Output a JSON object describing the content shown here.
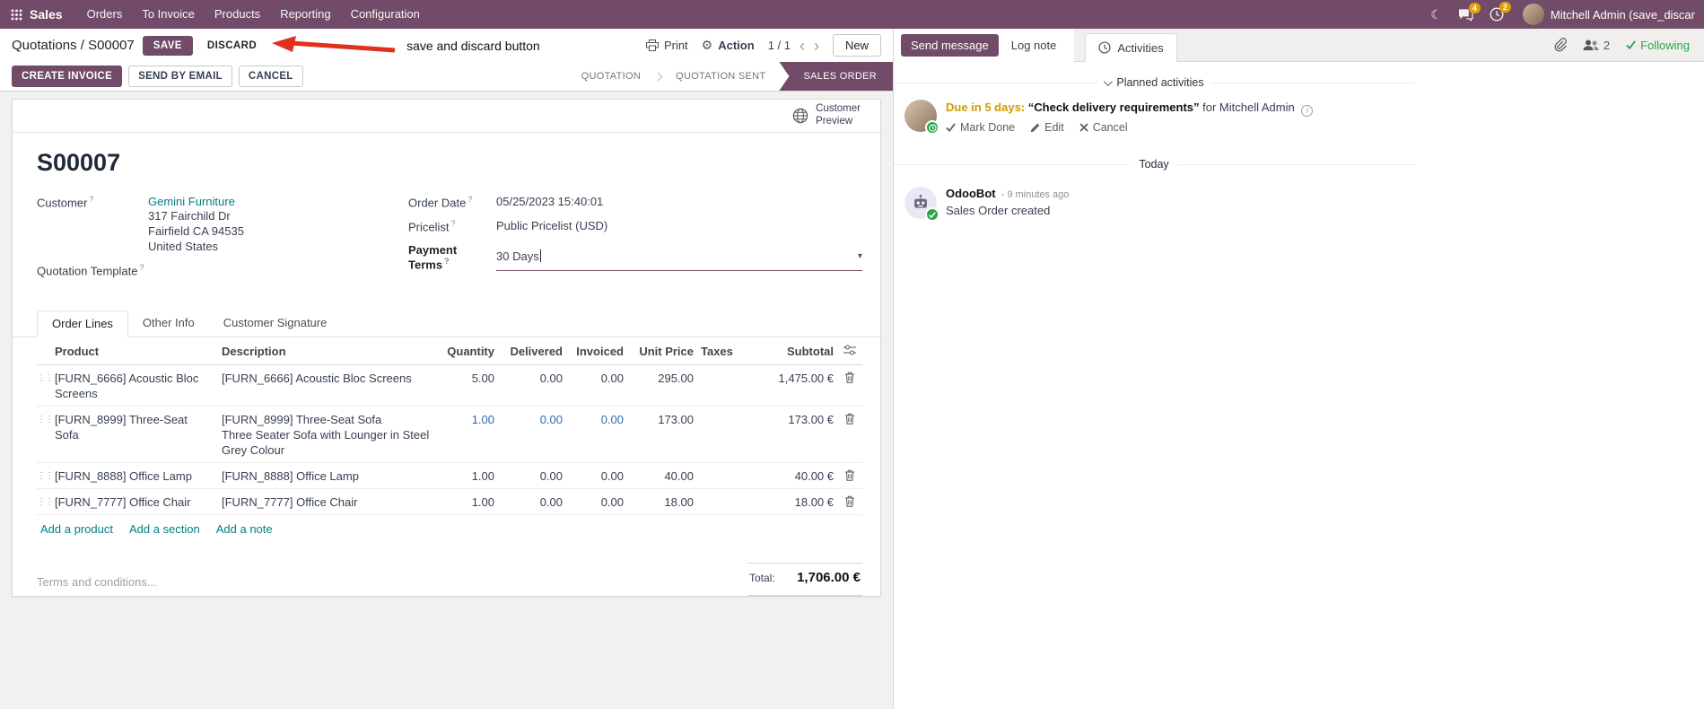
{
  "colors": {
    "topbar_bg": "#714B67",
    "primary_button": "#714B67",
    "link_teal": "#017E84",
    "modified_value_blue": "#2B6CB0",
    "activity_due_amber": "#CE9B00",
    "following_green": "#28A745",
    "annotation_red": "#E0301E",
    "notification_badge": "#E3A008"
  },
  "topbar": {
    "app_name": "Sales",
    "menus": [
      "Orders",
      "To Invoice",
      "Products",
      "Reporting",
      "Configuration"
    ],
    "messages_badge": "4",
    "activities_badge": "2",
    "user_name": "Mitchell Admin (save_discar"
  },
  "control_panel": {
    "breadcrumb_parent": "Quotations",
    "breadcrumb_separator": "/",
    "document_name": "S00007",
    "save_button": "SAVE",
    "discard_button": "DISCARD",
    "annotation_text": "save and discard button",
    "print_button": "Print",
    "action_button": "Action",
    "pager": "1 / 1",
    "new_button": "New"
  },
  "statusbar": {
    "create_invoice_button": "CREATE INVOICE",
    "send_by_email_button": "SEND BY EMAIL",
    "cancel_button": "CANCEL",
    "steps": [
      {
        "label": "QUOTATION"
      },
      {
        "label": "QUOTATION SENT"
      },
      {
        "label": "SALES ORDER"
      }
    ],
    "active_step": "SALES ORDER"
  },
  "sheet": {
    "customer_preview_line1": "Customer",
    "customer_preview_line2": "Preview",
    "title": "S00007",
    "customer": {
      "label": "Customer",
      "name": "Gemini Furniture",
      "address_line1": "317 Fairchild Dr",
      "address_line2": "Fairfield CA 94535",
      "address_line3": "United States"
    },
    "quotation_template_label": "Quotation Template",
    "order_date": {
      "label": "Order Date",
      "value": "05/25/2023 15:40:01"
    },
    "pricelist": {
      "label": "Pricelist",
      "value": "Public Pricelist (USD)"
    },
    "payment_terms": {
      "label": "Payment Terms",
      "value": "30 Days"
    },
    "tabs": [
      "Order Lines",
      "Other Info",
      "Customer Signature"
    ],
    "active_tab": "Order Lines"
  },
  "order_lines": {
    "columns": {
      "product": "Product",
      "description": "Description",
      "quantity": "Quantity",
      "delivered": "Delivered",
      "invoiced": "Invoiced",
      "unit_price": "Unit Price",
      "taxes": "Taxes",
      "subtotal": "Subtotal"
    },
    "rows": [
      {
        "product": "[FURN_6666] Acoustic Bloc Screens",
        "description": "[FURN_6666] Acoustic Bloc Screens",
        "description_line2": "",
        "quantity": "5.00",
        "delivered": "0.00",
        "invoiced": "0.00",
        "unit_price": "295.00",
        "taxes": "",
        "subtotal": "1,475.00 €"
      },
      {
        "product": "[FURN_8999] Three-Seat Sofa",
        "description": "[FURN_8999] Three-Seat Sofa",
        "description_line2": "Three Seater Sofa with Lounger in Steel Grey Colour",
        "quantity": "1.00",
        "delivered": "0.00",
        "invoiced": "0.00",
        "unit_price": "173.00",
        "taxes": "",
        "subtotal": "173.00 €"
      },
      {
        "product": "[FURN_8888] Office Lamp",
        "description": "[FURN_8888] Office Lamp",
        "description_line2": "",
        "quantity": "1.00",
        "delivered": "0.00",
        "invoiced": "0.00",
        "unit_price": "40.00",
        "taxes": "",
        "subtotal": "40.00 €"
      },
      {
        "product": "[FURN_7777] Office Chair",
        "description": "[FURN_7777] Office Chair",
        "description_line2": "",
        "quantity": "1.00",
        "delivered": "0.00",
        "invoiced": "0.00",
        "unit_price": "18.00",
        "taxes": "",
        "subtotal": "18.00 €"
      }
    ],
    "add_product_link": "Add a product",
    "add_section_link": "Add a section",
    "add_note_link": "Add a note",
    "terms_placeholder": "Terms and conditions...",
    "total_label": "Total:",
    "total_value": "1,706.00 €"
  },
  "chatter": {
    "send_message_button": "Send message",
    "log_note_button": "Log note",
    "activities_tab": "Activities",
    "followers_count": "2",
    "following_label": "Following",
    "planned_activities_header": "Planned activities",
    "activity": {
      "due_text": "Due in 5 days:",
      "summary": "“Check delivery requirements”",
      "assigned_text": "for Mitchell Admin",
      "mark_done": "Mark Done",
      "edit": "Edit",
      "cancel": "Cancel"
    },
    "date_divider": "Today",
    "message": {
      "author": "OdooBot",
      "timestamp": "- 9 minutes ago",
      "body": "Sales Order created"
    }
  },
  "icons": {
    "gear": "⚙",
    "moon": "☾",
    "caret_down": "▾",
    "chevron_left": "‹",
    "chevron_right": "›",
    "drag_handle": "⋮⋮",
    "help": "?",
    "info": "i"
  }
}
